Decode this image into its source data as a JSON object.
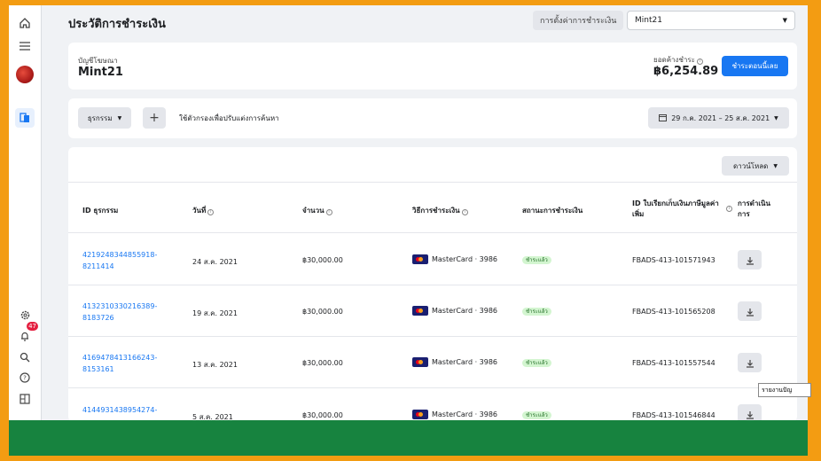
{
  "page": {
    "title": "ประวัติการชำระเงิน"
  },
  "header": {
    "settings_label": "การตั้งค่าการชำระเงิน",
    "account_select": "Mint21"
  },
  "account": {
    "label": "บัญชีโฆษณา",
    "name": "Mint21",
    "balance_label": "ยอดค้างชำระ",
    "balance": "฿6,254.89",
    "pay_now": "ชำระตอนนี้เลย"
  },
  "filters": {
    "transaction_label": "ธุรกรรม",
    "hint": "ใช้ตัวกรองเพื่อปรับแต่งการค้นหา",
    "date_range": "29 ก.ค. 2021 – 25 ส.ค. 2021"
  },
  "table": {
    "download_label": "ดาวน์โหลด",
    "headers": {
      "id": "ID ธุรกรรม",
      "date": "วันที่",
      "amount": "จำนวน",
      "method": "วิธีการชำระเงิน",
      "status": "สถานะการชำระเงิน",
      "invoice": "ID ใบเรียกเก็บเงินภาษีมูลค่าเพิ่ม",
      "action": "การดำเนินการ"
    },
    "rows": [
      {
        "id": "4219248344855918-8211414",
        "date": "24 ส.ค. 2021",
        "amount": "฿30,000.00",
        "method": "MasterCard · 3986",
        "status": "ชำระแล้ว",
        "invoice": "FBADS-413-101571943"
      },
      {
        "id": "4132310330216389-8183726",
        "date": "19 ส.ค. 2021",
        "amount": "฿30,000.00",
        "method": "MasterCard · 3986",
        "status": "ชำระแล้ว",
        "invoice": "FBADS-413-101565208"
      },
      {
        "id": "4169478413166243-8153161",
        "date": "13 ส.ค. 2021",
        "amount": "฿30,000.00",
        "method": "MasterCard · 3986",
        "status": "ชำระแล้ว",
        "invoice": "FBADS-413-101557544"
      },
      {
        "id": "4144931438954274-",
        "date": "5 ส.ค. 2021",
        "amount": "฿30,000.00",
        "method": "MasterCard · 3986",
        "status": "ชำระแล้ว",
        "invoice": "FBADS-413-101546844"
      }
    ]
  },
  "sidebar": {
    "notification_count": "47"
  },
  "tooltip": "รายงานปัญ"
}
